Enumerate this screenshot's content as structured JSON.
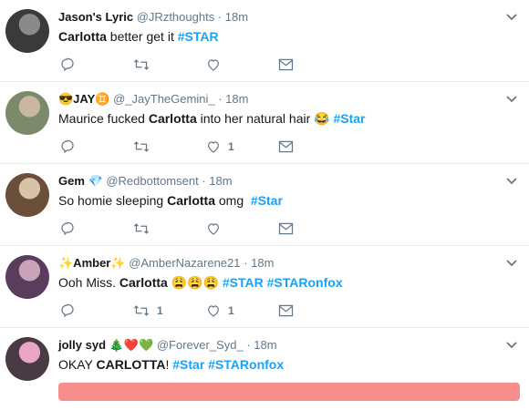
{
  "tweets": [
    {
      "name": "Jason's Lyric",
      "name_emoji": "",
      "handle": "@JRzthoughts",
      "dot": "·",
      "time": "18m",
      "segments": [
        {
          "t": "Carlotta",
          "k": "bold"
        },
        {
          "t": " better get it ",
          "k": "plain"
        },
        {
          "t": "#STAR",
          "k": "hashtag"
        }
      ],
      "reply_count": "",
      "retweet_count": "",
      "like_count": ""
    },
    {
      "name": "😎JAY♊",
      "name_emoji": "",
      "handle": "@_JayTheGemini_",
      "dot": "·",
      "time": "18m",
      "segments": [
        {
          "t": "Maurice fucked ",
          "k": "plain"
        },
        {
          "t": "Carlotta",
          "k": "bold"
        },
        {
          "t": " into her natural hair 😂 ",
          "k": "plain"
        },
        {
          "t": "#Star",
          "k": "hashtag"
        }
      ],
      "reply_count": "",
      "retweet_count": "",
      "like_count": "1"
    },
    {
      "name": "Gem",
      "name_emoji": "💎",
      "handle": "@Redbottomsent",
      "dot": "·",
      "time": "18m",
      "segments": [
        {
          "t": "So homie sleeping ",
          "k": "plain"
        },
        {
          "t": "Carlotta",
          "k": "bold"
        },
        {
          "t": " omg  ",
          "k": "plain"
        },
        {
          "t": "#Star",
          "k": "hashtag"
        }
      ],
      "reply_count": "",
      "retweet_count": "",
      "like_count": ""
    },
    {
      "name": "✨Amber✨",
      "name_emoji": "",
      "handle": "@AmberNazarene21",
      "dot": "·",
      "time": "18m",
      "segments": [
        {
          "t": "Ooh Miss. ",
          "k": "plain"
        },
        {
          "t": "Carlotta",
          "k": "bold"
        },
        {
          "t": " 😩😩😩 ",
          "k": "plain"
        },
        {
          "t": "#STAR",
          "k": "hashtag"
        },
        {
          "t": " ",
          "k": "plain"
        },
        {
          "t": "#STARonfox",
          "k": "hashtag"
        }
      ],
      "reply_count": "",
      "retweet_count": "1",
      "like_count": "1"
    },
    {
      "name": "jolly syd",
      "name_emoji": "🎄❤️💚",
      "handle": "@Forever_Syd_",
      "dot": "·",
      "time": "18m",
      "segments": [
        {
          "t": "OKAY ",
          "k": "plain"
        },
        {
          "t": "CARLOTTA",
          "k": "bold"
        },
        {
          "t": "! ",
          "k": "plain"
        },
        {
          "t": "#Star",
          "k": "hashtag"
        },
        {
          "t": " ",
          "k": "plain"
        },
        {
          "t": "#STARonfox",
          "k": "hashtag"
        }
      ],
      "reply_count": "",
      "retweet_count": "",
      "like_count": ""
    }
  ],
  "icons": {
    "reply": "reply-icon",
    "retweet": "retweet-icon",
    "like": "heart-icon",
    "dm": "envelope-icon",
    "caret": "chevron-down-icon"
  },
  "colors": {
    "hashtag": "#1da1f2",
    "muted": "#657786",
    "banner": "#f78e8e"
  }
}
